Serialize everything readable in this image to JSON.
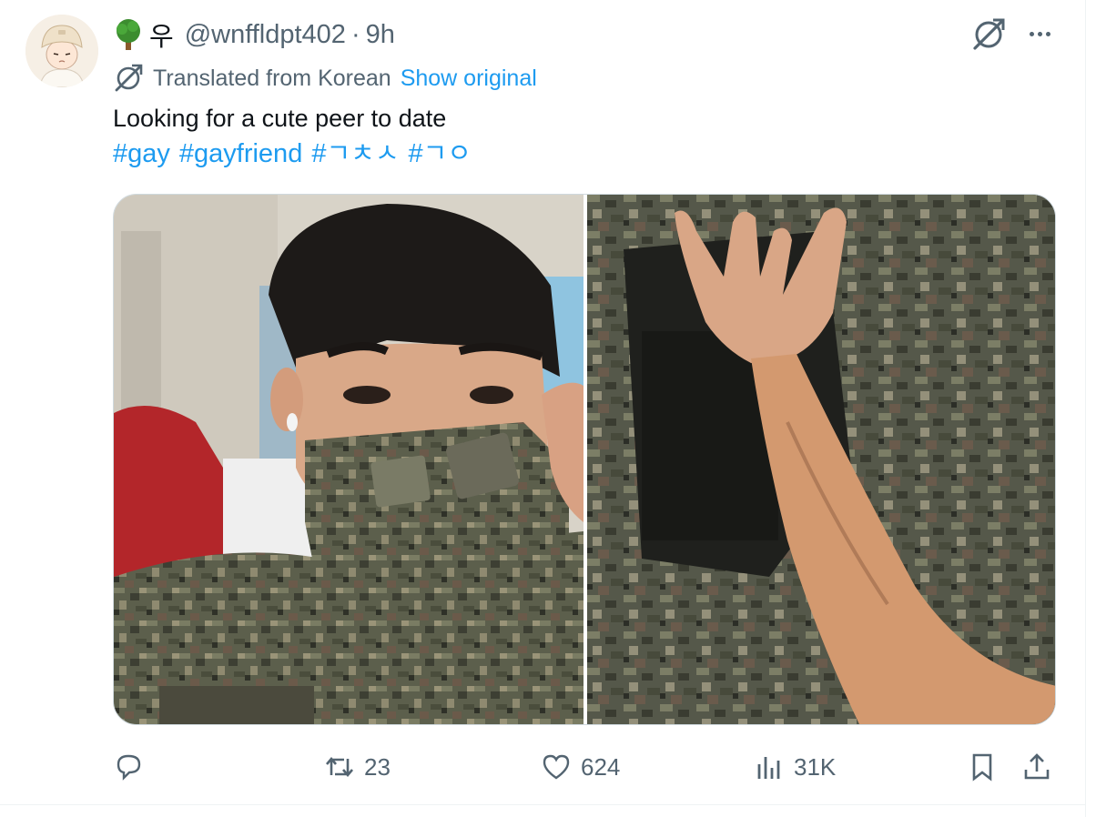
{
  "tweet": {
    "name": "우",
    "handle": "@wnffldpt402",
    "separator": "·",
    "time": "9h",
    "translated_label": "Translated from Korean",
    "show_original": "Show original",
    "text": "Looking for a cute peer to date",
    "hashtags": [
      "#gay",
      "#gayfriend",
      "#ㄱㅊㅅ",
      "#ㄱㅇ"
    ]
  },
  "media": {
    "photos": [
      "soldier-selfie-photo",
      "arm-hand-sign-photo"
    ]
  },
  "actions": {
    "reply_count": "",
    "retweet_count": "23",
    "like_count": "624",
    "views_count": "31K"
  },
  "icons": {
    "reply": "reply-icon",
    "retweet": "retweet-icon",
    "like": "heart-icon",
    "views": "views-icon",
    "bookmark": "bookmark-icon",
    "share": "share-icon",
    "grok": "grok-icon",
    "more": "more-icon"
  },
  "colors": {
    "link": "#1d9bf0",
    "muted": "#536471",
    "text": "#0f1419"
  }
}
